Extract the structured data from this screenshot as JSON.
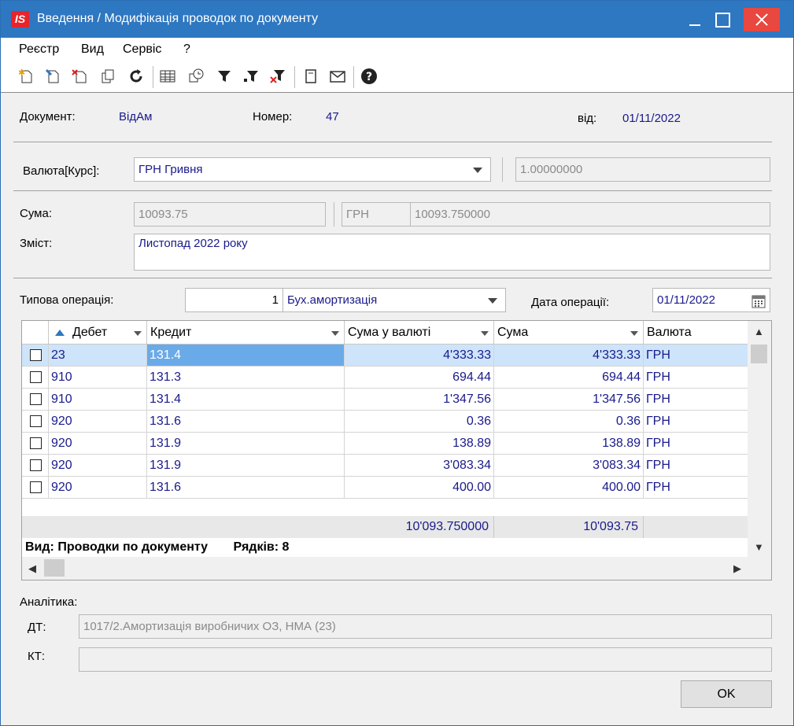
{
  "window": {
    "logo_text": "IS",
    "title": "Введення / Модифікація проводок по документу"
  },
  "menu": [
    "Реєстр",
    "Вид",
    "Сервіс",
    "?"
  ],
  "toolbar": {
    "icons": [
      "new-doc-icon",
      "edit-doc-icon",
      "delete-doc-icon",
      "copy-icon",
      "refresh-icon",
      "table-icon",
      "clock-icon",
      "filter-icon",
      "filter-add-icon",
      "filter-clear-icon",
      "sheet-icon",
      "mail-icon",
      "help-icon"
    ]
  },
  "doc": {
    "document_label": "Документ:",
    "document_value": "ВідАм",
    "number_label": "Номер:",
    "number_value": "47",
    "date_label": "від:",
    "date_value": "01/11/2022"
  },
  "currency": {
    "label": "Валюта[Курс]:",
    "value": "ГРН Гривня",
    "rate": "1.00000000"
  },
  "sum": {
    "label": "Сума:",
    "value": "10093.75",
    "currency": "ГРН",
    "currency_value": "10093.750000"
  },
  "content": {
    "label": "Зміст:",
    "value": "Листопад 2022 року"
  },
  "operation": {
    "label": "Типова операція:",
    "code": "1",
    "name": "Бух.амортизація",
    "date_label": "Дата операції:",
    "date_value": "01/11/2022"
  },
  "grid": {
    "columns": [
      "Дебет",
      "Кредит",
      "Сума у валюті",
      "Сума",
      "Валюта"
    ],
    "rows": [
      {
        "debit": "23",
        "credit": "131.4",
        "sum_cur": "4'333.33",
        "sum": "4'333.33",
        "cur": "ГРН"
      },
      {
        "debit": "910",
        "credit": "131.3",
        "sum_cur": "694.44",
        "sum": "694.44",
        "cur": "ГРН"
      },
      {
        "debit": "910",
        "credit": "131.4",
        "sum_cur": "1'347.56",
        "sum": "1'347.56",
        "cur": "ГРН"
      },
      {
        "debit": "920",
        "credit": "131.6",
        "sum_cur": "0.36",
        "sum": "0.36",
        "cur": "ГРН"
      },
      {
        "debit": "920",
        "credit": "131.9",
        "sum_cur": "138.89",
        "sum": "138.89",
        "cur": "ГРН"
      },
      {
        "debit": "920",
        "credit": "131.9",
        "sum_cur": "3'083.34",
        "sum": "3'083.34",
        "cur": "ГРН"
      },
      {
        "debit": "920",
        "credit": "131.6",
        "sum_cur": "400.00",
        "sum": "400.00",
        "cur": "ГРН"
      }
    ],
    "total_sum_cur": "10'093.750000",
    "total_sum": "10'093.75",
    "view_label": "Вид: Проводки по документу",
    "rows_label": "Рядків: 8"
  },
  "analytics": {
    "label": "Аналітика:",
    "dt_label": "ДТ:",
    "dt_value": "1017/2.Амортизація виробничих ОЗ, НМА (23)",
    "kt_label": "КТ:",
    "kt_value": ""
  },
  "ok_label": "OK"
}
